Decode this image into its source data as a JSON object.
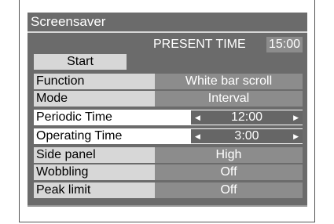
{
  "title": "Screensaver",
  "present_time": {
    "label": "PRESENT  TIME",
    "value": "15:00"
  },
  "start_label": "Start",
  "rows": [
    {
      "label": "Function",
      "value": "White bar scroll"
    },
    {
      "label": "Mode",
      "value": "Interval"
    },
    {
      "label": "Periodic Time",
      "value": "12:00"
    },
    {
      "label": "Operating Time",
      "value": "3:00"
    },
    {
      "label": "Side panel",
      "value": "High"
    },
    {
      "label": "Wobbling",
      "value": "Off"
    },
    {
      "label": "Peak limit",
      "value": "Off"
    }
  ],
  "icons": {
    "left": "arrow-left-icon",
    "right": "arrow-right-icon"
  }
}
